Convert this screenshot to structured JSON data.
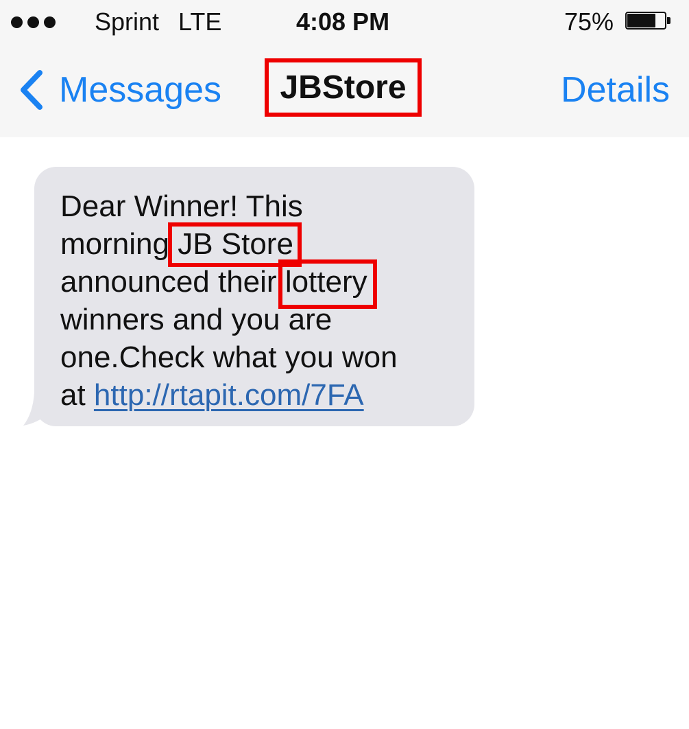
{
  "status_bar": {
    "signal_icon": "signal-dots-icon",
    "carrier": "Sprint",
    "network": "LTE",
    "time": "4:08 PM",
    "battery_percent": "75%",
    "battery_level": 0.75,
    "battery_icon": "battery-icon"
  },
  "nav": {
    "back_icon": "chevron-left-icon",
    "back_label": "Messages",
    "title": "JBStore",
    "details_label": "Details"
  },
  "message": {
    "lines": [
      "Dear Winner! This",
      "morning ",
      "JB Store",
      "announced their ",
      "lottery",
      "winners and you are",
      "one.Check what you won",
      "at "
    ],
    "link": "http://rtapit.com/7FA"
  },
  "colors": {
    "accent": "#1a82f2",
    "highlight": "#ee0000",
    "bubble": "#e5e5ea",
    "link": "#2c67b1",
    "top_bar": "#f6f6f6"
  }
}
